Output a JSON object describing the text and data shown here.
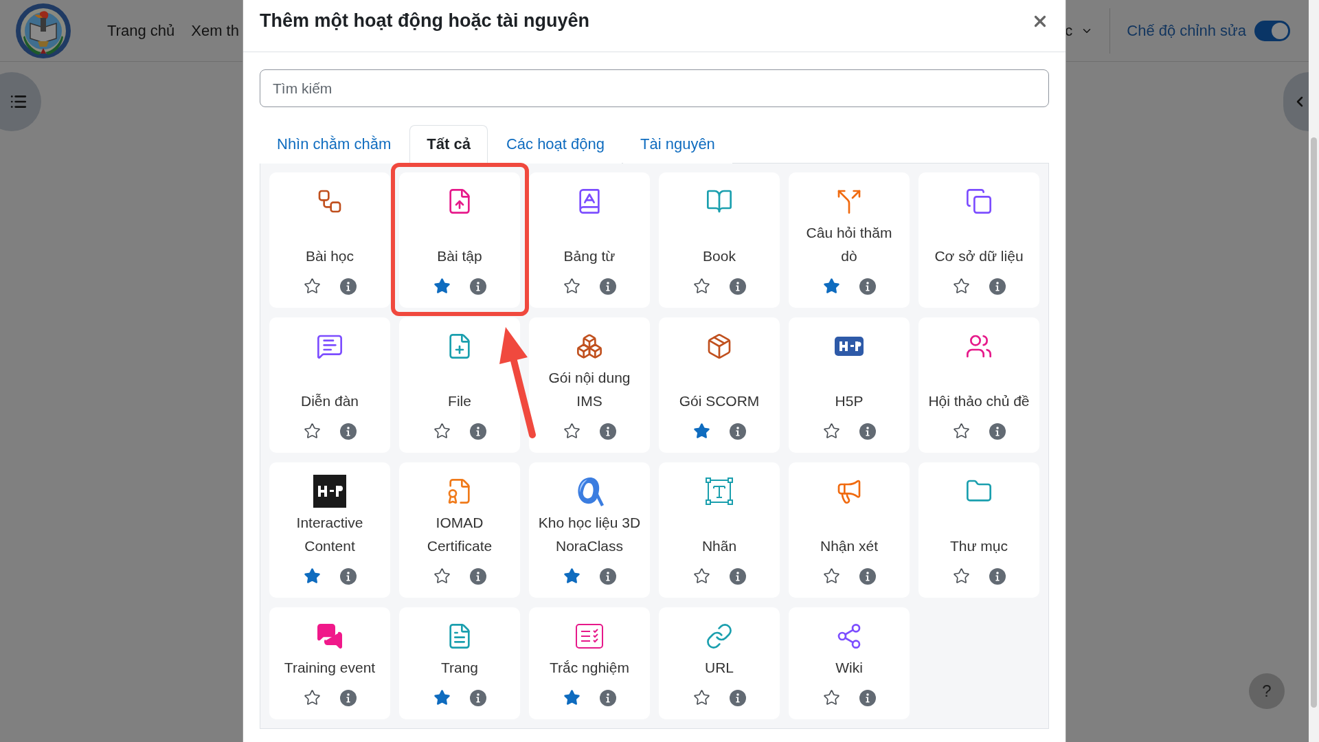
{
  "page": {
    "nav": [
      "Trang chủ",
      "Xem th"
    ],
    "menu_fragment": "c",
    "edit_mode": {
      "label": "Chế độ chỉnh sửa",
      "on": true
    },
    "help_button": "?"
  },
  "dialog": {
    "title": "Thêm một hoạt động hoặc tài nguyên",
    "search": {
      "placeholder": "Tìm kiếm"
    },
    "tabs": [
      {
        "label": "Nhìn chằm chằm",
        "selected": false
      },
      {
        "label": "Tất cả",
        "selected": true
      },
      {
        "label": "Các hoạt động",
        "selected": false
      },
      {
        "label": "Tài nguyên",
        "selected": false
      }
    ],
    "items": [
      {
        "name": "Bài học",
        "starred": false,
        "highlighted": false,
        "color": "#c0501e"
      },
      {
        "name": "Bài tập",
        "starred": true,
        "highlighted": true,
        "color": "#e6198a"
      },
      {
        "name": "Bảng từ",
        "starred": false,
        "highlighted": false,
        "color": "#7c4dff"
      },
      {
        "name": "Book",
        "starred": false,
        "highlighted": false,
        "color": "#1a9fae"
      },
      {
        "name": "Câu hỏi thăm dò",
        "starred": true,
        "highlighted": false,
        "color": "#f06a0f"
      },
      {
        "name": "Cơ sở dữ liệu",
        "starred": false,
        "highlighted": false,
        "color": "#7c4dff"
      },
      {
        "name": "Diễn đàn",
        "starred": false,
        "highlighted": false,
        "color": "#7c4dff"
      },
      {
        "name": "File",
        "starred": false,
        "highlighted": false,
        "color": "#1a9fae"
      },
      {
        "name": "Gói nội dung IMS",
        "starred": false,
        "highlighted": false,
        "color": "#c0501e"
      },
      {
        "name": "Gói SCORM",
        "starred": true,
        "highlighted": false,
        "color": "#c0501e"
      },
      {
        "name": "H5P",
        "starred": false,
        "highlighted": false,
        "color": "#2e5aa8"
      },
      {
        "name": "Hội thảo chủ đề",
        "starred": false,
        "highlighted": false,
        "color": "#e6198a"
      },
      {
        "name": "Interactive Content",
        "starred": true,
        "highlighted": false,
        "color": "#1a1a1a"
      },
      {
        "name": "IOMAD Certificate",
        "starred": false,
        "highlighted": false,
        "color": "#f07a1a"
      },
      {
        "name": "Kho học liệu 3D NoraClass",
        "starred": true,
        "highlighted": false,
        "color": "#3b7de0"
      },
      {
        "name": "Nhãn",
        "starred": false,
        "highlighted": false,
        "color": "#1a9fae"
      },
      {
        "name": "Nhận xét",
        "starred": false,
        "highlighted": false,
        "color": "#f06a0f"
      },
      {
        "name": "Thư mục",
        "starred": false,
        "highlighted": false,
        "color": "#1a9fae"
      },
      {
        "name": "Training event",
        "starred": false,
        "highlighted": false,
        "color": "#f0198a"
      },
      {
        "name": "Trang",
        "starred": true,
        "highlighted": false,
        "color": "#1a9fae"
      },
      {
        "name": "Trắc nghiệm",
        "starred": true,
        "highlighted": false,
        "color": "#e6198a"
      },
      {
        "name": "URL",
        "starred": false,
        "highlighted": false,
        "color": "#1a9fae"
      },
      {
        "name": "Wiki",
        "starred": false,
        "highlighted": false,
        "color": "#7c4dff"
      }
    ]
  }
}
